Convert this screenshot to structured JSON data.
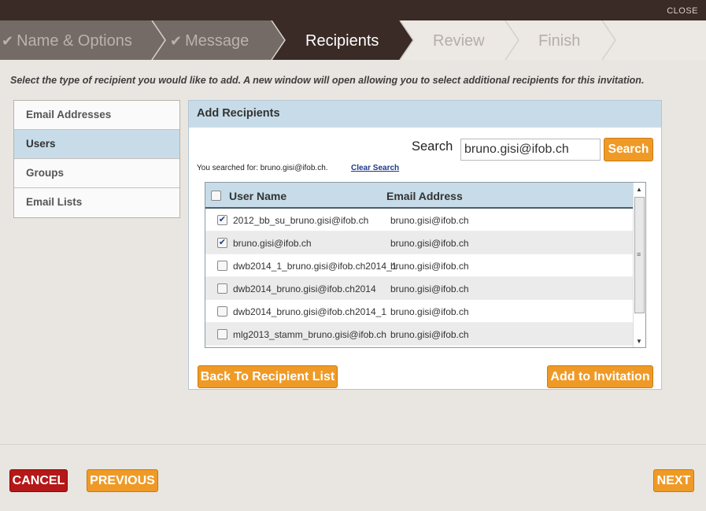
{
  "topbar": {
    "close_label": "CLOSE"
  },
  "steps": [
    {
      "label": "Name & Options",
      "checked": true
    },
    {
      "label": "Message",
      "checked": true
    },
    {
      "label": "Recipients",
      "checked": false,
      "active": true
    },
    {
      "label": "Review",
      "checked": false
    },
    {
      "label": "Finish",
      "checked": false
    }
  ],
  "check_glyph": "✔",
  "instructions": "Select the type of recipient you would like to add. A new window will open allowing you to select additional recipients for this invitation.",
  "recipient_types": [
    "Email Addresses",
    "Users",
    "Groups",
    "Email Lists"
  ],
  "panel": {
    "title": "Add Recipients",
    "search_label": "Search",
    "search_value": "bruno.gisi@ifob.ch",
    "search_button": "Search",
    "searched_text": "You searched for: bruno.gisi@ifob.ch.",
    "clear_search": "Clear Search",
    "columns": [
      "User Name",
      "Email Address"
    ],
    "rows": [
      {
        "user": "2012_bb_su_bruno.gisi@ifob.ch",
        "email": "bruno.gisi@ifob.ch",
        "checked": true
      },
      {
        "user": "bruno.gisi@ifob.ch",
        "email": "bruno.gisi@ifob.ch",
        "checked": true
      },
      {
        "user": "dwb2014_1_bruno.gisi@ifob.ch2014_1",
        "email": "bruno.gisi@ifob.ch",
        "checked": false
      },
      {
        "user": "dwb2014_bruno.gisi@ifob.ch2014",
        "email": "bruno.gisi@ifob.ch",
        "checked": false
      },
      {
        "user": "dwb2014_bruno.gisi@ifob.ch2014_1",
        "email": "bruno.gisi@ifob.ch",
        "checked": false
      },
      {
        "user": "mlg2013_stamm_bruno.gisi@ifob.ch",
        "email": "bruno.gisi@ifob.ch",
        "checked": false
      }
    ],
    "back_button": "Back To Recipient List",
    "add_button": "Add to Invitation"
  },
  "footer": {
    "cancel": "CANCEL",
    "previous": "PREVIOUS",
    "next": "NEXT"
  },
  "colors": {
    "accent": "#ef9a26",
    "active_step": "#3a2b26",
    "cancel": "#b51818",
    "selected": "#c7dce8"
  }
}
